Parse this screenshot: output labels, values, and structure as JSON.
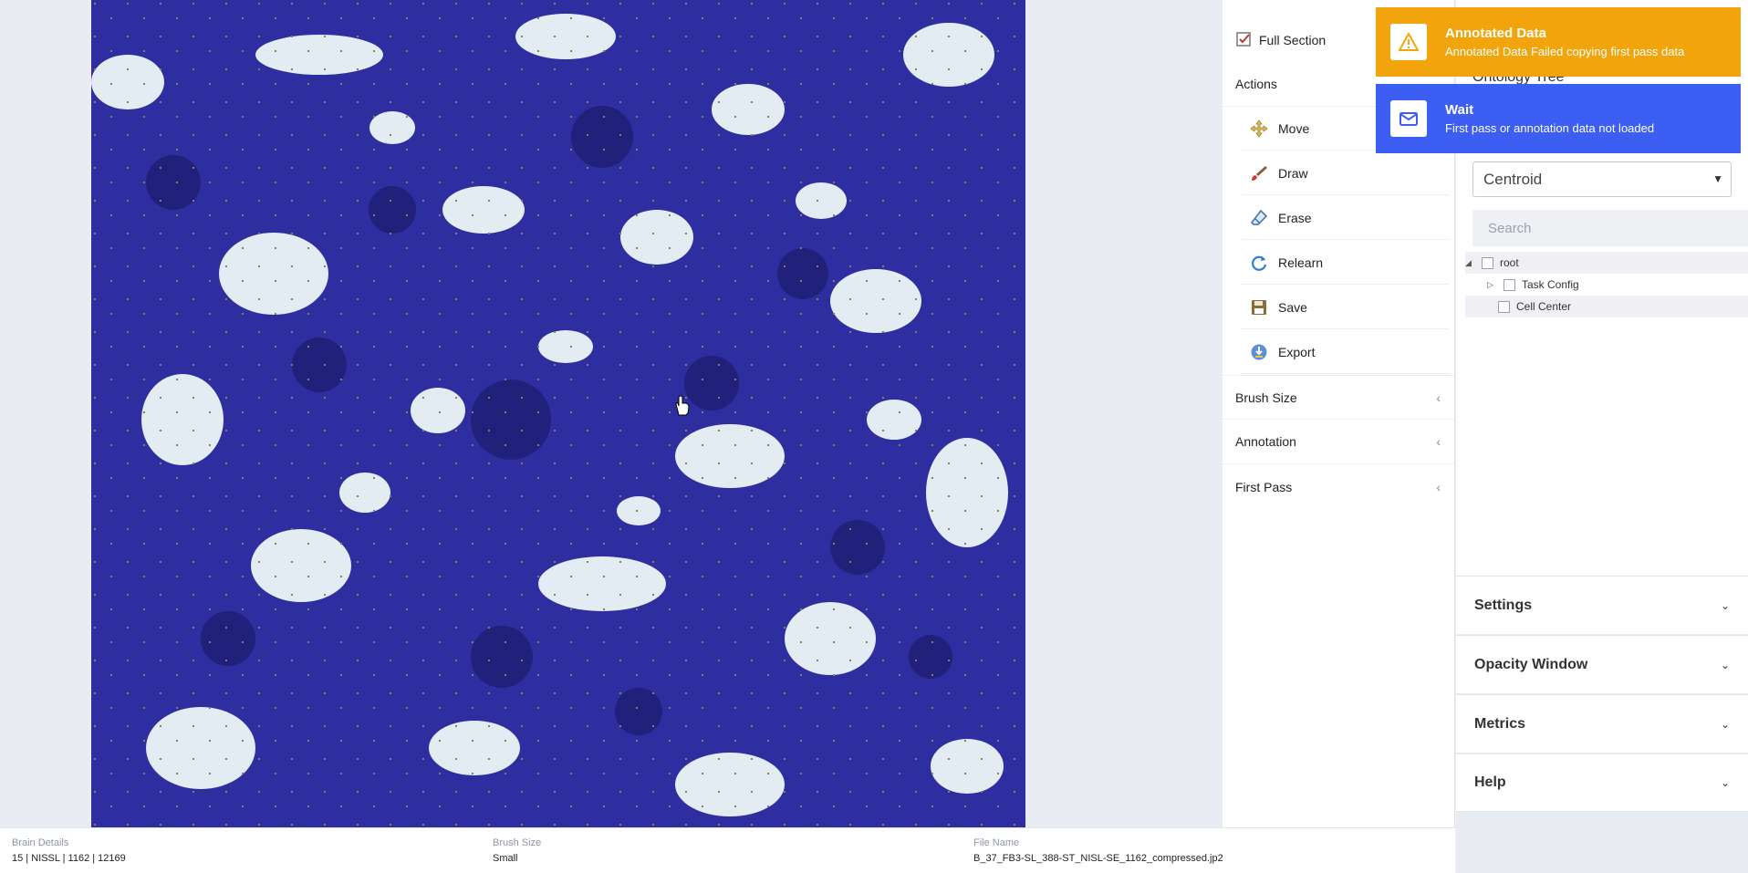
{
  "tools": {
    "full_section": "Full Section",
    "actions": "Actions",
    "actions_list": [
      "Move",
      "Draw",
      "Erase",
      "Relearn",
      "Save",
      "Export"
    ],
    "brush_size": "Brush Size",
    "annotation": "Annotation",
    "first_pass": "First Pass"
  },
  "ontology": {
    "title": "Ontology Tree",
    "select_value": "Centroid",
    "search_placeholder": "Search",
    "tree": [
      {
        "label": "root",
        "expanded": true
      },
      {
        "label": "Task Config",
        "expanded": false
      },
      {
        "label": "Cell Center"
      }
    ]
  },
  "accordions": [
    "Settings",
    "Opacity Window",
    "Metrics",
    "Help"
  ],
  "toasts": {
    "warning": {
      "title": "Annotated Data",
      "message": "Annotated Data Failed copying first pass data",
      "color": "#f2a40c"
    },
    "info": {
      "title": "Wait",
      "message": "First pass or annotation data not loaded",
      "color": "#3d5ef2"
    }
  },
  "status": {
    "brain_details_label": "Brain Details",
    "brain_details_value": "15 | NISSL | 1162 | 12169",
    "brush_size_label": "Brush Size",
    "brush_size_value": "Small",
    "file_name_label": "File Name",
    "file_name_value": "B_37_FB3-SL_388-ST_NISL-SE_1162_compressed.jp2"
  },
  "icons": {
    "full_section": "full-section-icon",
    "move": "move-icon",
    "draw": "brush-icon",
    "erase": "eraser-icon",
    "relearn": "refresh-icon",
    "save": "floppy-icon",
    "export": "export-icon",
    "warning": "warning-icon",
    "info": "mail-icon"
  }
}
